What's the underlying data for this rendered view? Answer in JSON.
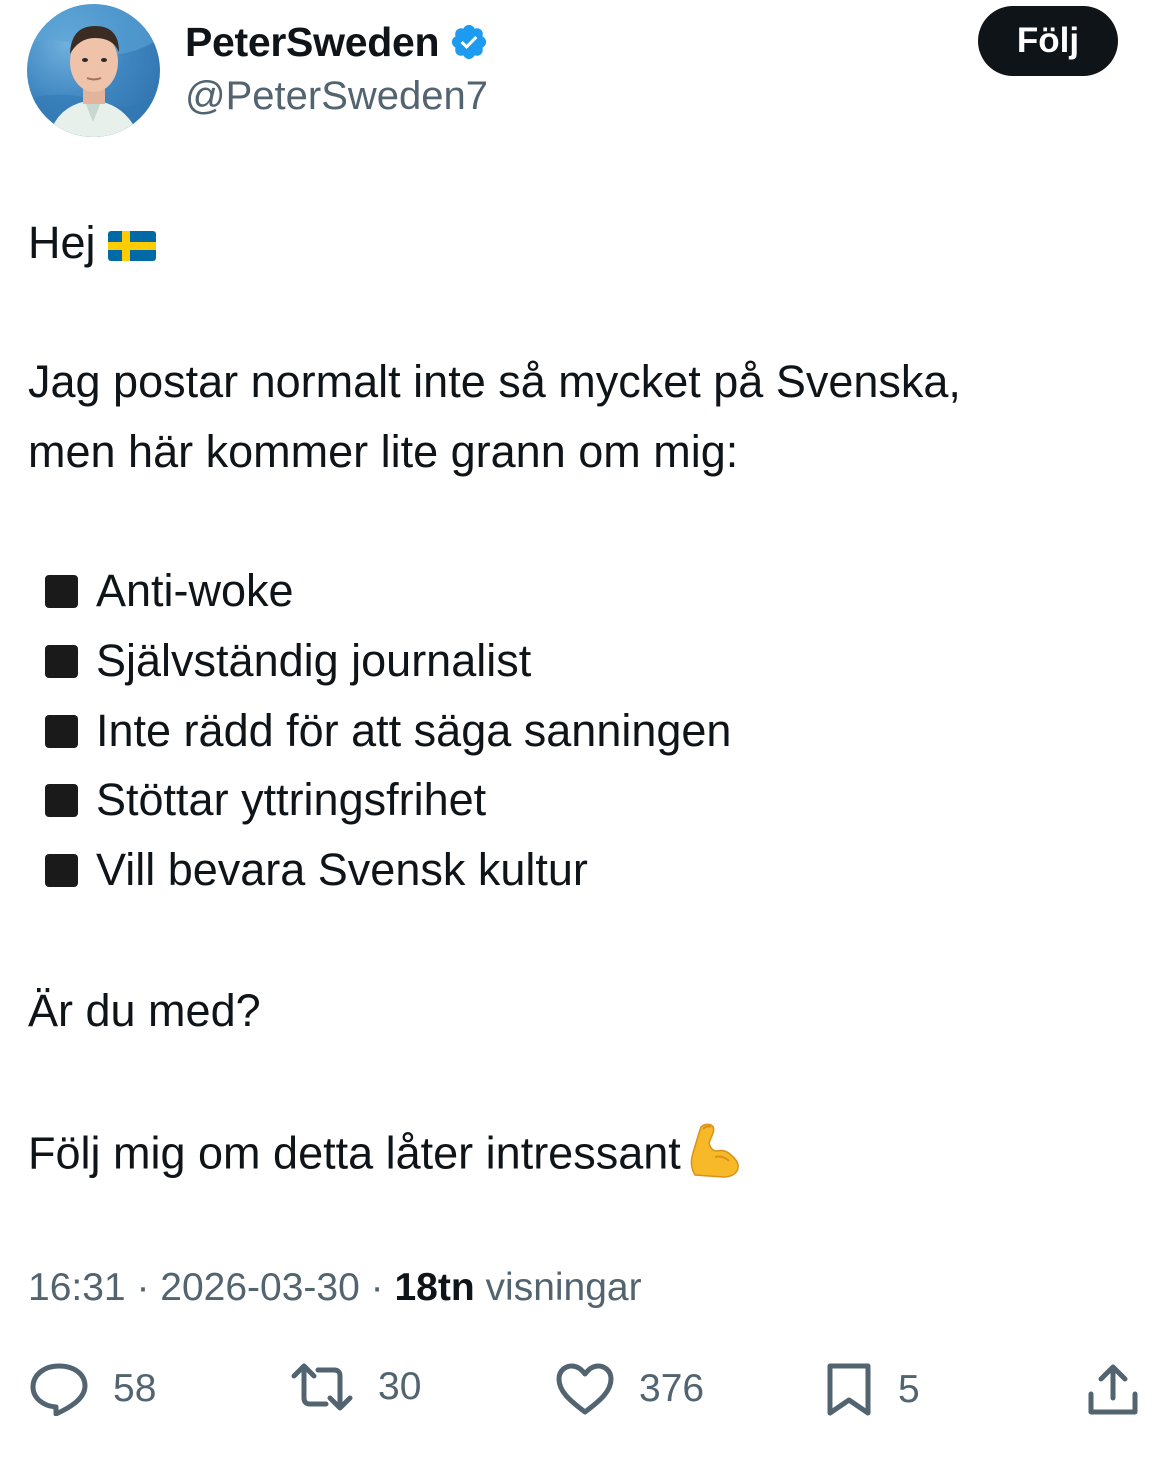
{
  "header": {
    "display_name": "PeterSweden",
    "handle": "@PeterSweden7",
    "follow_label": "Följ",
    "verified_color": "#1d9bf0"
  },
  "tweet": {
    "greeting": "Hej",
    "flag_icon": "sweden-flag-icon",
    "intro_line_1": "Jag postar normalt inte så mycket på Svenska,",
    "intro_line_2": "men här kommer lite grann om mig:",
    "bullets": [
      "Anti-woke",
      "Självständig journalist",
      "Inte rädd för att säga sanningen",
      "Stöttar yttringsfrihet",
      "Vill bevara Svensk kultur"
    ],
    "question": "Är du med?",
    "cta": "Följ mig om detta låter intressant",
    "cta_icon": "flexed-biceps-icon"
  },
  "meta": {
    "time": "16:31",
    "separator": "·",
    "date": "2026-03-30",
    "views_count": "18tn",
    "views_label": "visningar"
  },
  "actions": {
    "replies": "58",
    "reposts": "30",
    "likes": "376",
    "bookmarks": "5"
  },
  "colors": {
    "text": "#0f1419",
    "secondary": "#536471",
    "button_bg": "#0f1419"
  }
}
